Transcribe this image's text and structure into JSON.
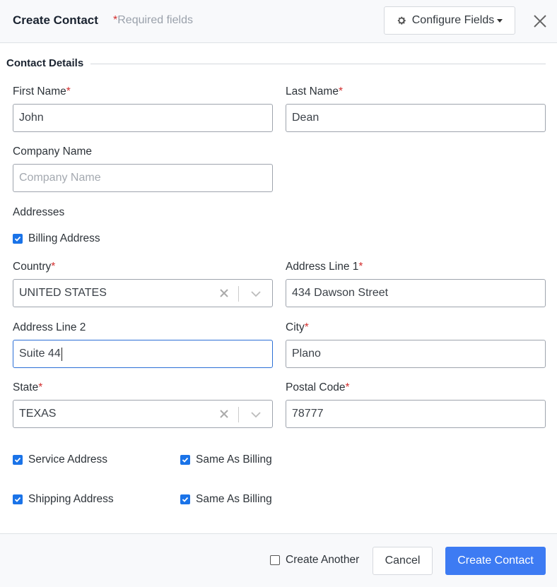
{
  "header": {
    "title": "Create Contact",
    "required_star": "*",
    "required_note": "Required fields",
    "configure_fields_label": "Configure Fields",
    "configure_icon": "gear-icon",
    "close_icon": "close-icon"
  },
  "section": {
    "title": "Contact Details"
  },
  "fields": {
    "first_name": {
      "label": "First Name",
      "required": "*",
      "value": "John"
    },
    "last_name": {
      "label": "Last Name",
      "required": "*",
      "value": "Dean"
    },
    "company_name": {
      "label": "Company Name",
      "value": "",
      "placeholder": "Company Name"
    },
    "country": {
      "label": "Country",
      "required": "*",
      "value": "UNITED STATES"
    },
    "address_line_1": {
      "label": "Address Line 1",
      "required": "*",
      "value": "434 Dawson Street"
    },
    "address_line_2": {
      "label": "Address Line 2",
      "value": "Suite 44"
    },
    "city": {
      "label": "City",
      "required": "*",
      "value": "Plano"
    },
    "state": {
      "label": "State",
      "required": "*",
      "value": "TEXAS"
    },
    "postal_code": {
      "label": "Postal Code",
      "required": "*",
      "value": "78777"
    }
  },
  "addresses": {
    "label": "Addresses",
    "billing": {
      "label": "Billing Address",
      "checked": true
    },
    "service": {
      "label": "Service Address",
      "checked": true,
      "same_as_billing_label": "Same As Billing",
      "same_as_billing_checked": true
    },
    "shipping": {
      "label": "Shipping Address",
      "checked": true,
      "same_as_billing_label": "Same As Billing",
      "same_as_billing_checked": true
    }
  },
  "footer": {
    "create_another_label": "Create Another",
    "create_another_checked": false,
    "cancel_label": "Cancel",
    "create_label": "Create Contact"
  },
  "colors": {
    "primary": "#3d7bf3",
    "required": "#d32f2f",
    "checkbox": "#1a73e8",
    "focus": "#2b6fd6"
  }
}
